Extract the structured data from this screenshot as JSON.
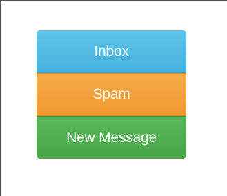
{
  "menu": {
    "items": [
      {
        "label": "Inbox",
        "color": "#4fb9e3"
      },
      {
        "label": "Spam",
        "color": "#f0a23a"
      },
      {
        "label": "New Message",
        "color": "#4cae4c"
      }
    ]
  }
}
